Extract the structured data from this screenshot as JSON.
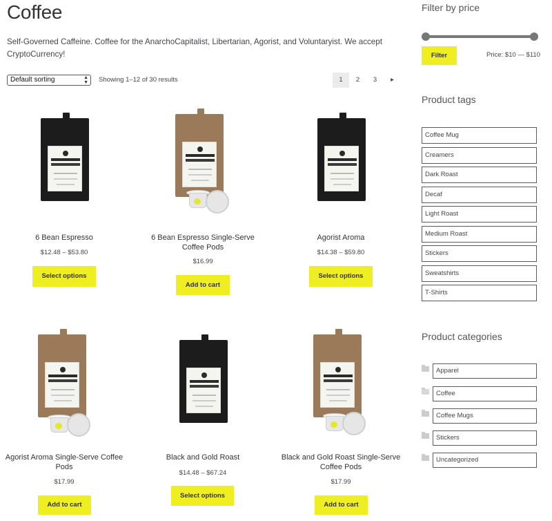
{
  "page": {
    "title": "Coffee",
    "intro": "Self-Governed Caffeine. Coffee for the AnarchoCapitalist, Libertarian, Agorist, and Voluntaryist. We accept CryptoCurrency!"
  },
  "toolbar": {
    "sort_selected": "Default sorting",
    "result_count": "Showing 1–12 of 30 results",
    "pagination": [
      "1",
      "2",
      "3"
    ],
    "next_icon": "▸"
  },
  "products": [
    {
      "name": "6 Bean Espresso",
      "price": "$12.48 – $53.80",
      "button": "Select options",
      "image": "black-bag"
    },
    {
      "name": "6 Bean Espresso Single-Serve Coffee Pods",
      "price": "$16.99",
      "button": "Add to cart",
      "image": "kraft-bag-with-pods"
    },
    {
      "name": "Agorist Aroma",
      "price": "$14.38 – $59.80",
      "button": "Select options",
      "image": "black-bag"
    },
    {
      "name": "Agorist Aroma Single-Serve Coffee Pods",
      "price": "$17.99",
      "button": "Add to cart",
      "image": "kraft-bag-with-pods"
    },
    {
      "name": "Black and Gold Roast",
      "price": "$14.48 – $67.24",
      "button": "Select options",
      "image": "black-bag"
    },
    {
      "name": "Black and Gold Roast Single-Serve Coffee Pods",
      "price": "$17.99",
      "button": "Add to cart",
      "image": "kraft-bag-with-pods"
    }
  ],
  "sidebar": {
    "price_filter": {
      "title": "Filter by price",
      "button": "Filter",
      "range_label": "Price: $10 — $110"
    },
    "tags": {
      "title": "Product tags",
      "items": [
        "Coffee Mug",
        "Creamers",
        "Dark Roast",
        "Decaf",
        "Light Roast",
        "Medium Roast",
        "Stickers",
        "Sweatshirts",
        "T-Shirts"
      ]
    },
    "categories": {
      "title": "Product categories",
      "items": [
        "Apparel",
        "Coffee",
        "Coffee Mugs",
        "Stickers",
        "Uncategorized"
      ]
    }
  },
  "colors": {
    "accent_button": "#eeee22",
    "text": "#43454b",
    "bag_black": "#1c1c1c",
    "bag_kraft": "#9b7a5a"
  }
}
